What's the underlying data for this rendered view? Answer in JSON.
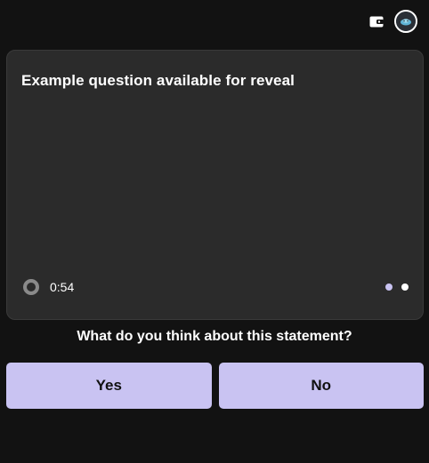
{
  "header": {
    "wallet_icon": "wallet-icon",
    "avatar_icon": "avatar-icon"
  },
  "card": {
    "question": "Example question available for reveal",
    "timer": {
      "icon": "timer-ring-icon",
      "text": "0:54"
    },
    "pager": {
      "count": 2,
      "active_index": 1
    }
  },
  "prompt": "What do you think about this statement?",
  "answers": {
    "yes_label": "Yes",
    "no_label": "No"
  },
  "colors": {
    "background": "#121212",
    "card": "#2b2b2b",
    "accent": "#c9c3f2",
    "text": "#ffffff",
    "button_text": "#111111"
  }
}
